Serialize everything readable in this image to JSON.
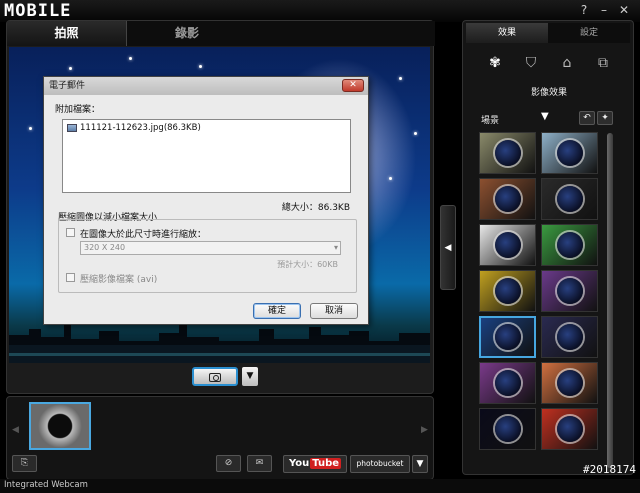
{
  "app": {
    "logo": "MOBILE",
    "window_buttons": [
      "?",
      "–",
      "✕"
    ]
  },
  "mode_tabs": [
    {
      "label": "拍照",
      "active": true
    },
    {
      "label": "錄影",
      "active": false
    }
  ],
  "dialog": {
    "title": "電子郵件",
    "attach_label": "附加檔案：",
    "file_name": "111121-112623.jpg(86.3KB)",
    "total_size": "總大小：86.3KB",
    "group_title": "壓縮圖像以減小檔案大小",
    "resize_checkbox_label": "在圖像大於此尺寸時進行縮放：",
    "resize_select_value": "320 X 240",
    "estimated_size": "預計大小：60KB",
    "compress_video_label": "壓縮影像檔案 (avi)",
    "ok_button": "確定",
    "cancel_button": "取消"
  },
  "right_panel": {
    "tabs": [
      {
        "label": "效果",
        "active": true
      },
      {
        "label": "設定",
        "active": false
      }
    ],
    "heading": "影像效果",
    "scene_label": "場景"
  },
  "bottom_bar": {
    "youtube_you": "You",
    "youtube_tube": "Tube",
    "photobucket": "photobucket"
  },
  "status": {
    "device_name": "Integrated Webcam"
  },
  "watermark": "#2018174",
  "colors": {
    "accent": "#46a6e0",
    "close_button": "#c0392b",
    "youtube_red": "#d02020"
  },
  "effects": [
    {
      "name": "effect-1",
      "bg": "#8a8a6a"
    },
    {
      "name": "effect-2",
      "bg": "#8eb0c8"
    },
    {
      "name": "effect-3",
      "bg": "#8c5030"
    },
    {
      "name": "effect-4",
      "bg": "#2a2a2a"
    },
    {
      "name": "effect-5",
      "bg": "#e8e8e8"
    },
    {
      "name": "effect-6",
      "bg": "#3a9a40"
    },
    {
      "name": "effect-7",
      "bg": "#c0a020"
    },
    {
      "name": "effect-8",
      "bg": "#6a3a8a"
    },
    {
      "name": "effect-9",
      "bg": "#1a4080"
    },
    {
      "name": "effect-10",
      "bg": "#2a2a50"
    },
    {
      "name": "effect-11",
      "bg": "#7a3a8a"
    },
    {
      "name": "effect-12",
      "bg": "#d07040"
    },
    {
      "name": "effect-13",
      "bg": "#0a0a1a"
    },
    {
      "name": "effect-14",
      "bg": "#c03020"
    }
  ]
}
